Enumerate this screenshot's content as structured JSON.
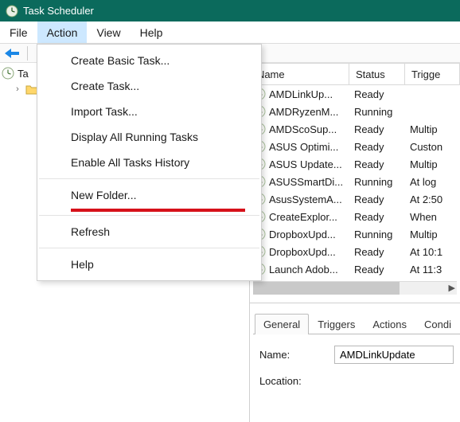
{
  "window": {
    "title": "Task Scheduler"
  },
  "menu": {
    "file": "File",
    "action": "Action",
    "view": "View",
    "help": "Help"
  },
  "action_menu": {
    "create_basic": "Create Basic Task...",
    "create_task": "Create Task...",
    "import_task": "Import Task...",
    "display_running": "Display All Running Tasks",
    "enable_history": "Enable All Tasks History",
    "new_folder": "New Folder...",
    "refresh": "Refresh",
    "help": "Help"
  },
  "tree": {
    "root": "Ta"
  },
  "columns": {
    "name": "Name",
    "status": "Status",
    "trigger": "Trigge"
  },
  "tasks": [
    {
      "name": "AMDLinkUp...",
      "status": "Ready",
      "trigger": ""
    },
    {
      "name": "AMDRyzenM...",
      "status": "Running",
      "trigger": ""
    },
    {
      "name": "AMDScoSup...",
      "status": "Ready",
      "trigger": "Multip"
    },
    {
      "name": "ASUS Optimi...",
      "status": "Ready",
      "trigger": "Custon"
    },
    {
      "name": "ASUS Update...",
      "status": "Ready",
      "trigger": "Multip"
    },
    {
      "name": "ASUSSmartDi...",
      "status": "Running",
      "trigger": "At log"
    },
    {
      "name": "AsusSystemA...",
      "status": "Ready",
      "trigger": "At 2:50"
    },
    {
      "name": "CreateExplor...",
      "status": "Ready",
      "trigger": "When"
    },
    {
      "name": "DropboxUpd...",
      "status": "Running",
      "trigger": "Multip"
    },
    {
      "name": "DropboxUpd...",
      "status": "Ready",
      "trigger": "At 10:1"
    },
    {
      "name": "Launch Adob...",
      "status": "Ready",
      "trigger": "At 11:3"
    }
  ],
  "tabs": {
    "general": "General",
    "triggers": "Triggers",
    "actions": "Actions",
    "conditions": "Condi"
  },
  "detail": {
    "name_label": "Name:",
    "name_value": "AMDLinkUpdate",
    "location_label": "Location:"
  }
}
